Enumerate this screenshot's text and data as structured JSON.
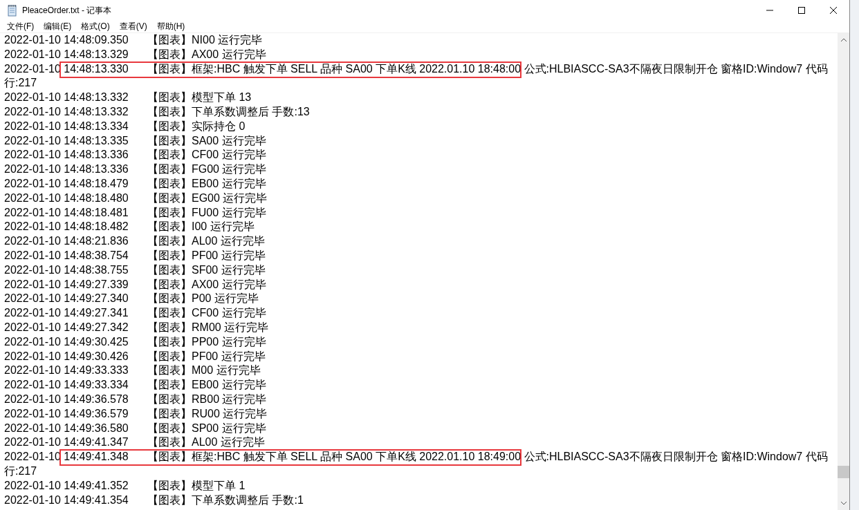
{
  "window": {
    "title": "PleaceOrder.txt - 记事本"
  },
  "menu": [
    {
      "label": "文件(F)"
    },
    {
      "label": "编辑(E)"
    },
    {
      "label": "格式(O)"
    },
    {
      "label": "查看(V)"
    },
    {
      "label": "帮助(H)"
    }
  ],
  "lines": [
    {
      "time": "2022-01-10 14:48:09.350",
      "text": "【图表】NI00 运行完毕",
      "highlighted": false
    },
    {
      "time": "2022-01-10 14:48:13.329",
      "text": "【图表】AX00 运行完毕",
      "highlighted": false
    },
    {
      "time": "2022-01-10 14:48:13.330",
      "text": "【图表】框架:HBC 触发下单 SELL 品种 SA00 下单K线 2022.01.10 18:48:00 公式:HLBIASCC-SA3不隔夜日限制开仓 窗格ID:Window7 代码",
      "continuation": "行:217",
      "highlighted": true
    },
    {
      "time": "2022-01-10 14:48:13.332",
      "text": "【图表】模型下单 13",
      "highlighted": false
    },
    {
      "time": "2022-01-10 14:48:13.332",
      "text": "【图表】下单系数调整后 手数:13",
      "highlighted": false
    },
    {
      "time": "2022-01-10 14:48:13.334",
      "text": "【图表】实际持仓 0",
      "highlighted": false
    },
    {
      "time": "2022-01-10 14:48:13.335",
      "text": "【图表】SA00 运行完毕",
      "highlighted": false
    },
    {
      "time": "2022-01-10 14:48:13.336",
      "text": "【图表】CF00 运行完毕",
      "highlighted": false
    },
    {
      "time": "2022-01-10 14:48:13.336",
      "text": "【图表】FG00 运行完毕",
      "highlighted": false
    },
    {
      "time": "2022-01-10 14:48:18.479",
      "text": "【图表】EB00 运行完毕",
      "highlighted": false
    },
    {
      "time": "2022-01-10 14:48:18.480",
      "text": "【图表】EG00 运行完毕",
      "highlighted": false
    },
    {
      "time": "2022-01-10 14:48:18.481",
      "text": "【图表】FU00 运行完毕",
      "highlighted": false
    },
    {
      "time": "2022-01-10 14:48:18.482",
      "text": "【图表】I00 运行完毕",
      "highlighted": false
    },
    {
      "time": "2022-01-10 14:48:21.836",
      "text": "【图表】AL00 运行完毕",
      "highlighted": false
    },
    {
      "time": "2022-01-10 14:48:38.754",
      "text": "【图表】PF00 运行完毕",
      "highlighted": false
    },
    {
      "time": "2022-01-10 14:48:38.755",
      "text": "【图表】SF00 运行完毕",
      "highlighted": false
    },
    {
      "time": "2022-01-10 14:49:27.339",
      "text": "【图表】AX00 运行完毕",
      "highlighted": false
    },
    {
      "time": "2022-01-10 14:49:27.340",
      "text": "【图表】P00 运行完毕",
      "highlighted": false
    },
    {
      "time": "2022-01-10 14:49:27.341",
      "text": "【图表】CF00 运行完毕",
      "highlighted": false
    },
    {
      "time": "2022-01-10 14:49:27.342",
      "text": "【图表】RM00 运行完毕",
      "highlighted": false
    },
    {
      "time": "2022-01-10 14:49:30.425",
      "text": "【图表】PP00 运行完毕",
      "highlighted": false
    },
    {
      "time": "2022-01-10 14:49:30.426",
      "text": "【图表】PF00 运行完毕",
      "highlighted": false
    },
    {
      "time": "2022-01-10 14:49:33.333",
      "text": "【图表】M00 运行完毕",
      "highlighted": false
    },
    {
      "time": "2022-01-10 14:49:33.334",
      "text": "【图表】EB00 运行完毕",
      "highlighted": false
    },
    {
      "time": "2022-01-10 14:49:36.578",
      "text": "【图表】RB00 运行完毕",
      "highlighted": false
    },
    {
      "time": "2022-01-10 14:49:36.579",
      "text": "【图表】RU00 运行完毕",
      "highlighted": false
    },
    {
      "time": "2022-01-10 14:49:36.580",
      "text": "【图表】SP00 运行完毕",
      "highlighted": false
    },
    {
      "time": "2022-01-10 14:49:41.347",
      "text": "【图表】AL00 运行完毕",
      "highlighted": false
    },
    {
      "time": "2022-01-10 14:49:41.348",
      "text": "【图表】框架:HBC 触发下单 SELL 品种 SA00 下单K线 2022.01.10 18:49:00 公式:HLBIASCC-SA3不隔夜日限制开仓 窗格ID:Window7 代码",
      "continuation": "行:217",
      "highlighted": true
    },
    {
      "time": "2022-01-10 14:49:41.352",
      "text": "【图表】模型下单 1",
      "highlighted": false
    },
    {
      "time": "2022-01-10 14:49:41.354",
      "text": "【图表】下单系数调整后 手数:1",
      "highlighted": false
    }
  ]
}
